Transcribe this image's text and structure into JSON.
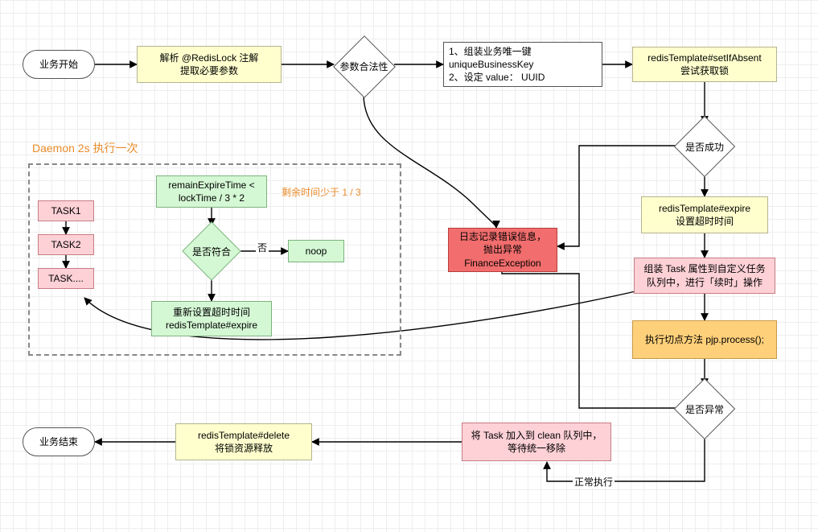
{
  "chart_data": {
    "type": "flowchart",
    "title": "",
    "nodes": [
      {
        "id": "start",
        "label": "业务开始",
        "type": "terminator"
      },
      {
        "id": "parse",
        "label": "解析 @RedisLock 注解\n提取必要参数",
        "type": "process",
        "style": "yellow"
      },
      {
        "id": "argCheck",
        "label": "参数合法性",
        "type": "decision"
      },
      {
        "id": "buildKey",
        "label": "1、组装业务唯一键 uniqueBusinessKey\n2、设定 value： UUID",
        "type": "process",
        "style": "white"
      },
      {
        "id": "setIfAbsent",
        "label": "redisTemplate#setIfAbsent\n尝试获取锁",
        "type": "process",
        "style": "yellow"
      },
      {
        "id": "successCheck",
        "label": "是否成功",
        "type": "decision"
      },
      {
        "id": "expire",
        "label": "redisTemplate#expire\n设置超时时间",
        "type": "process",
        "style": "yellow"
      },
      {
        "id": "queueTask",
        "label": "组装 Task 属性到自定义任务队列中，进行「续时」操作",
        "type": "process",
        "style": "pink"
      },
      {
        "id": "proceed",
        "label": "执行切点方法 pjp.process();",
        "type": "process",
        "style": "orange"
      },
      {
        "id": "exceptionCheck",
        "label": "是否异常",
        "type": "decision"
      },
      {
        "id": "cleanTask",
        "label": "将 Task 加入到 clean 队列中，等待统一移除",
        "type": "process",
        "style": "pink"
      },
      {
        "id": "delete",
        "label": "redisTemplate#delete\n将锁资源释放",
        "type": "process",
        "style": "yellow"
      },
      {
        "id": "end",
        "label": "业务结束",
        "type": "terminator"
      },
      {
        "id": "error",
        "label": "日志记录错误信息，\n抛出异常\nFinanceException",
        "type": "process",
        "style": "red"
      },
      {
        "id": "remainCheck",
        "label": "remainExpireTime <\nlockTime / 3 * 2",
        "type": "process",
        "style": "green"
      },
      {
        "id": "matchCheck",
        "label": "是否符合",
        "type": "decision"
      },
      {
        "id": "noop",
        "label": "noop",
        "type": "process",
        "style": "green"
      },
      {
        "id": "reExpire",
        "label": "重新设置超时时间\nredisTemplate#expire",
        "type": "process",
        "style": "green"
      },
      {
        "id": "task1",
        "label": "TASK1",
        "type": "process",
        "style": "pink"
      },
      {
        "id": "task2",
        "label": "TASK2",
        "type": "process",
        "style": "pink"
      },
      {
        "id": "taskN",
        "label": "TASK....",
        "type": "process",
        "style": "pink"
      }
    ],
    "edges": [
      {
        "from": "start",
        "to": "parse"
      },
      {
        "from": "parse",
        "to": "argCheck"
      },
      {
        "from": "argCheck",
        "to": "buildKey"
      },
      {
        "from": "argCheck",
        "to": "error"
      },
      {
        "from": "buildKey",
        "to": "setIfAbsent"
      },
      {
        "from": "setIfAbsent",
        "to": "successCheck"
      },
      {
        "from": "successCheck",
        "to": "expire"
      },
      {
        "from": "successCheck",
        "to": "error"
      },
      {
        "from": "expire",
        "to": "queueTask"
      },
      {
        "from": "queueTask",
        "to": "proceed"
      },
      {
        "from": "queueTask",
        "to": "taskN"
      },
      {
        "from": "proceed",
        "to": "exceptionCheck"
      },
      {
        "from": "exceptionCheck",
        "to": "cleanTask",
        "label": "正常执行"
      },
      {
        "from": "exceptionCheck",
        "to": "error"
      },
      {
        "from": "cleanTask",
        "to": "delete"
      },
      {
        "from": "delete",
        "to": "end"
      },
      {
        "from": "task1",
        "to": "task2"
      },
      {
        "from": "task2",
        "to": "taskN"
      },
      {
        "from": "remainCheck",
        "to": "matchCheck"
      },
      {
        "from": "matchCheck",
        "to": "noop",
        "label": "否"
      },
      {
        "from": "matchCheck",
        "to": "reExpire"
      }
    ],
    "groups": [
      {
        "id": "daemonGroup",
        "label": "Daemon 2s 执行一次",
        "contains": [
          "task1",
          "task2",
          "taskN",
          "remainCheck",
          "matchCheck",
          "noop",
          "reExpire"
        ]
      }
    ],
    "annotations": [
      {
        "id": "remainNote",
        "label": "剩余时间少于 1 / 3"
      }
    ]
  }
}
